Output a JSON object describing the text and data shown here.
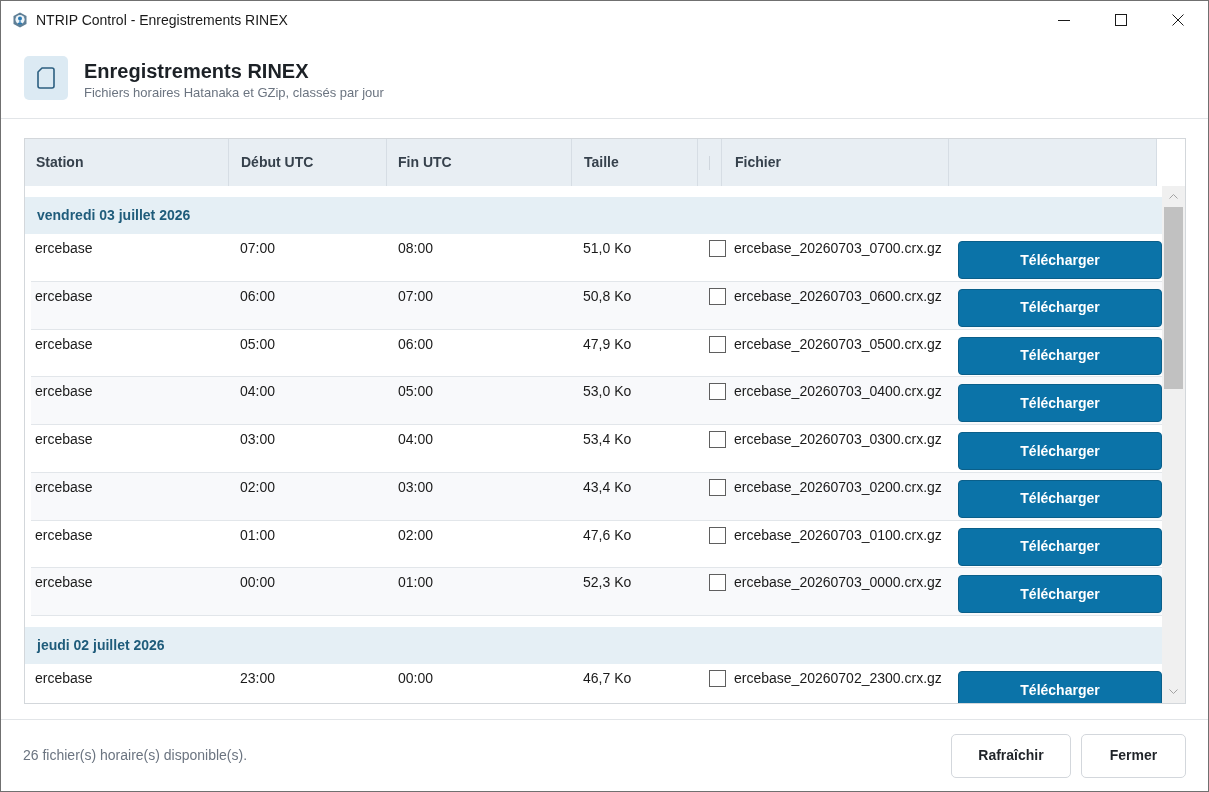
{
  "window": {
    "title": "NTRIP Control - Enregistrements RINEX"
  },
  "header": {
    "title": "Enregistrements RINEX",
    "subtitle": "Fichiers horaires Hatanaka et GZip, classés par jour"
  },
  "table": {
    "columns": [
      "Station",
      "Début UTC",
      "Fin UTC",
      "Taille",
      "Fichier"
    ],
    "groups": [
      {
        "label": "vendredi 03 juillet 2026",
        "rows": [
          {
            "station": "ercebase",
            "start": "07:00",
            "end": "08:00",
            "size": "51,0 Ko",
            "checked": false,
            "file": "ercebase_20260703_0700.crx.gz",
            "action": "Télécharger"
          },
          {
            "station": "ercebase",
            "start": "06:00",
            "end": "07:00",
            "size": "50,8 Ko",
            "checked": false,
            "file": "ercebase_20260703_0600.crx.gz",
            "action": "Télécharger"
          },
          {
            "station": "ercebase",
            "start": "05:00",
            "end": "06:00",
            "size": "47,9 Ko",
            "checked": false,
            "file": "ercebase_20260703_0500.crx.gz",
            "action": "Télécharger"
          },
          {
            "station": "ercebase",
            "start": "04:00",
            "end": "05:00",
            "size": "53,0 Ko",
            "checked": false,
            "file": "ercebase_20260703_0400.crx.gz",
            "action": "Télécharger"
          },
          {
            "station": "ercebase",
            "start": "03:00",
            "end": "04:00",
            "size": "53,4 Ko",
            "checked": false,
            "file": "ercebase_20260703_0300.crx.gz",
            "action": "Télécharger"
          },
          {
            "station": "ercebase",
            "start": "02:00",
            "end": "03:00",
            "size": "43,4 Ko",
            "checked": false,
            "file": "ercebase_20260703_0200.crx.gz",
            "action": "Télécharger"
          },
          {
            "station": "ercebase",
            "start": "01:00",
            "end": "02:00",
            "size": "47,6 Ko",
            "checked": false,
            "file": "ercebase_20260703_0100.crx.gz",
            "action": "Télécharger"
          },
          {
            "station": "ercebase",
            "start": "00:00",
            "end": "01:00",
            "size": "52,3 Ko",
            "checked": false,
            "file": "ercebase_20260703_0000.crx.gz",
            "action": "Télécharger"
          }
        ]
      },
      {
        "label": "jeudi 02 juillet 2026",
        "rows": [
          {
            "station": "ercebase",
            "start": "23:00",
            "end": "00:00",
            "size": "46,7 Ko",
            "checked": false,
            "file": "ercebase_20260702_2300.crx.gz",
            "action": "Télécharger"
          }
        ]
      }
    ]
  },
  "status_bar": {
    "text": "26 fichier(s) horaire(s) disponible(s)."
  },
  "buttons": [
    "Rafraîchir",
    "Fermer"
  ]
}
